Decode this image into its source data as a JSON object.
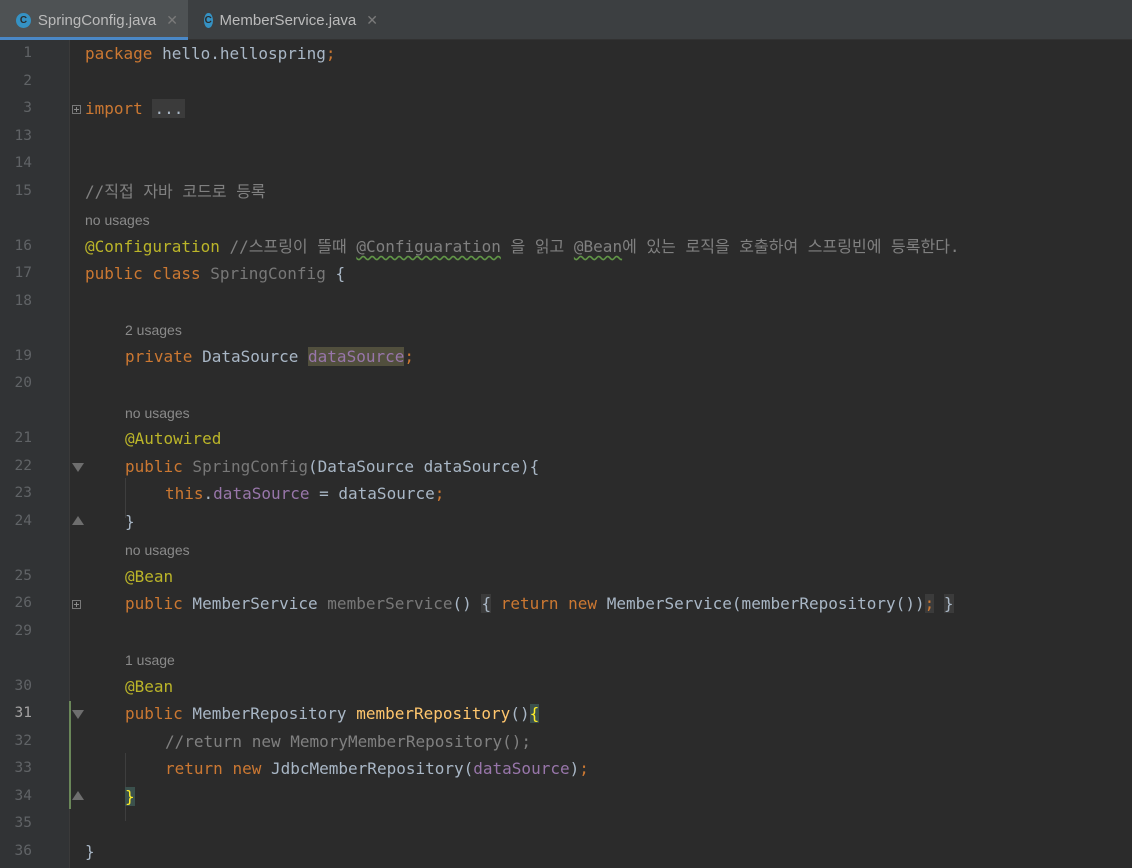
{
  "tabs": [
    {
      "label": "SpringConfig.java",
      "icon": "java-class-icon",
      "icon_letter": "C",
      "active": true
    },
    {
      "label": "MemberService.java",
      "icon": "java-class-icon",
      "icon_letter": "C",
      "active": false
    }
  ],
  "line_numbers": [
    "1",
    "2",
    "3",
    "13",
    "14",
    "15",
    "16",
    "17",
    "18",
    "19",
    "20",
    "21",
    "22",
    "23",
    "24",
    "25",
    "26",
    "29",
    "30",
    "31",
    "32",
    "33",
    "34",
    "35",
    "36"
  ],
  "current_line": "31",
  "hints": {
    "h1": "no usages",
    "h2": "2 usages",
    "h3": "no usages",
    "h4": "no usages",
    "h5": "1 usage"
  },
  "code": {
    "l1": {
      "kw": "package",
      "rest": " hello.hellospring",
      "semi": ";"
    },
    "l3": {
      "kw": "import",
      "sp": " ",
      "folded": "..."
    },
    "l15": {
      "comment": "//직접 자바 코드로 등록"
    },
    "l16": {
      "ann": "@Configuration",
      "c1": " //스프링이 뜰때 ",
      "c2": "@Configuaration",
      "c3": " 을 읽고 ",
      "c4": "@Bean",
      "c5": "에 있는 로직을 호출하여 스프링빈에 등록한다."
    },
    "l17": {
      "kw": "public class",
      "cls": " SpringConfig",
      "rest": " {"
    },
    "l19": {
      "kw": "private",
      "type": " DataSource ",
      "field": "dataSource",
      "semi": ";"
    },
    "l21": {
      "ann": "@Autowired"
    },
    "l22": {
      "kw": "public",
      "name": " SpringConfig",
      "rest": "(DataSource dataSource){"
    },
    "l23": {
      "kw": "this",
      "dot": ".",
      "field": "dataSource",
      "rest": " = dataSource",
      "semi": ";"
    },
    "l24": {
      "text": "}"
    },
    "l25": {
      "ann": "@Bean"
    },
    "l26": {
      "kw": "public",
      "type": " MemberService ",
      "name": "memberService",
      "paren": "()",
      "sp": " ",
      "ob": "{",
      "sp2": " ",
      "ret": "return",
      "sp3": " ",
      "new": "new",
      "rest": " MemberService(memberRepository())",
      "semi": ";",
      "sp4": " ",
      "cb": "}"
    },
    "l30": {
      "ann": "@Bean"
    },
    "l31": {
      "kw": "public",
      "type": " MemberRepository ",
      "name": "memberRepository",
      "paren": "()",
      "ob": "{"
    },
    "l32": {
      "comment": "//return new MemoryMemberRepository();"
    },
    "l33": {
      "ret": "return",
      "sp": " ",
      "new": "new",
      "mid": " JdbcMemberRepository(",
      "field": "dataSource",
      "close": ")",
      "semi": ";"
    },
    "l34": {
      "cb": "}"
    },
    "l36": {
      "cb": "}"
    }
  }
}
